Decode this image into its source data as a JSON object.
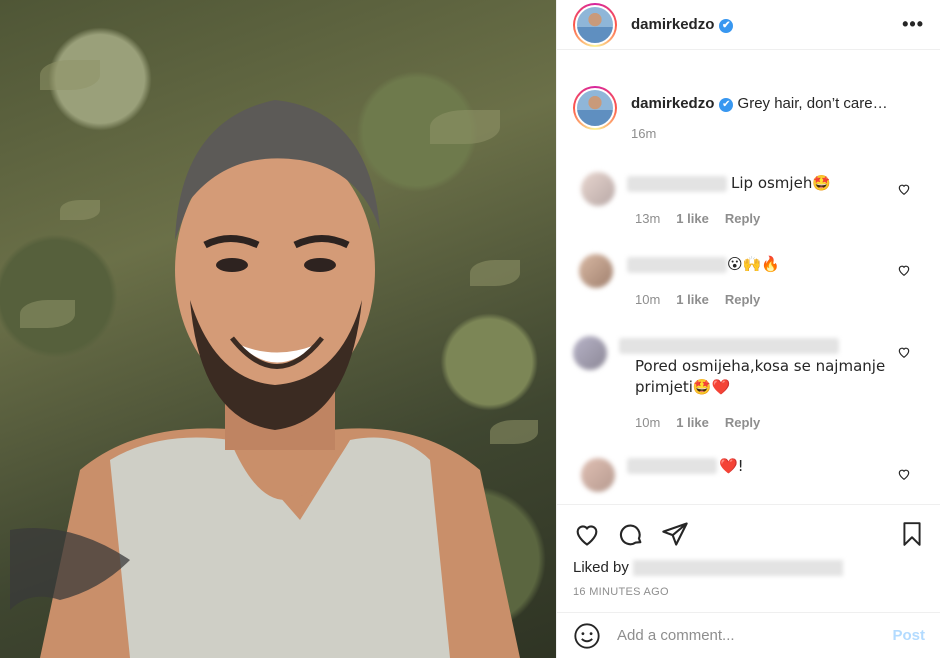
{
  "post": {
    "author": "damirkedzo",
    "verified_mark": "✔",
    "more_label": "•••",
    "caption": "Grey hair, don’t care…",
    "caption_time": "16m"
  },
  "comments": [
    {
      "text": "Lip osmjeh🤩",
      "time": "13m",
      "likes": "1 like",
      "reply": "Reply"
    },
    {
      "text": "😮🙌🔥",
      "time": "10m",
      "likes": "1 like",
      "reply": "Reply"
    },
    {
      "text": "Pored osmijeha,kosa se najmanje primjeti🤩❤️",
      "time": "10m",
      "likes": "1 like",
      "reply": "Reply"
    },
    {
      "text": "❤️!",
      "time": "",
      "likes": "",
      "reply": ""
    }
  ],
  "footer": {
    "liked_by_label": "Liked by",
    "time_ago": "16 MINUTES AGO",
    "add_comment_placeholder": "Add a comment...",
    "post_label": "Post"
  },
  "colors": {
    "accent": "#3897f0",
    "post_disabled": "#b3dbff",
    "muted": "#8e8e8e"
  },
  "icons": [
    "heart-icon",
    "comment-icon",
    "share-icon",
    "bookmark-icon",
    "emoji-icon",
    "verified-icon",
    "more-icon"
  ]
}
